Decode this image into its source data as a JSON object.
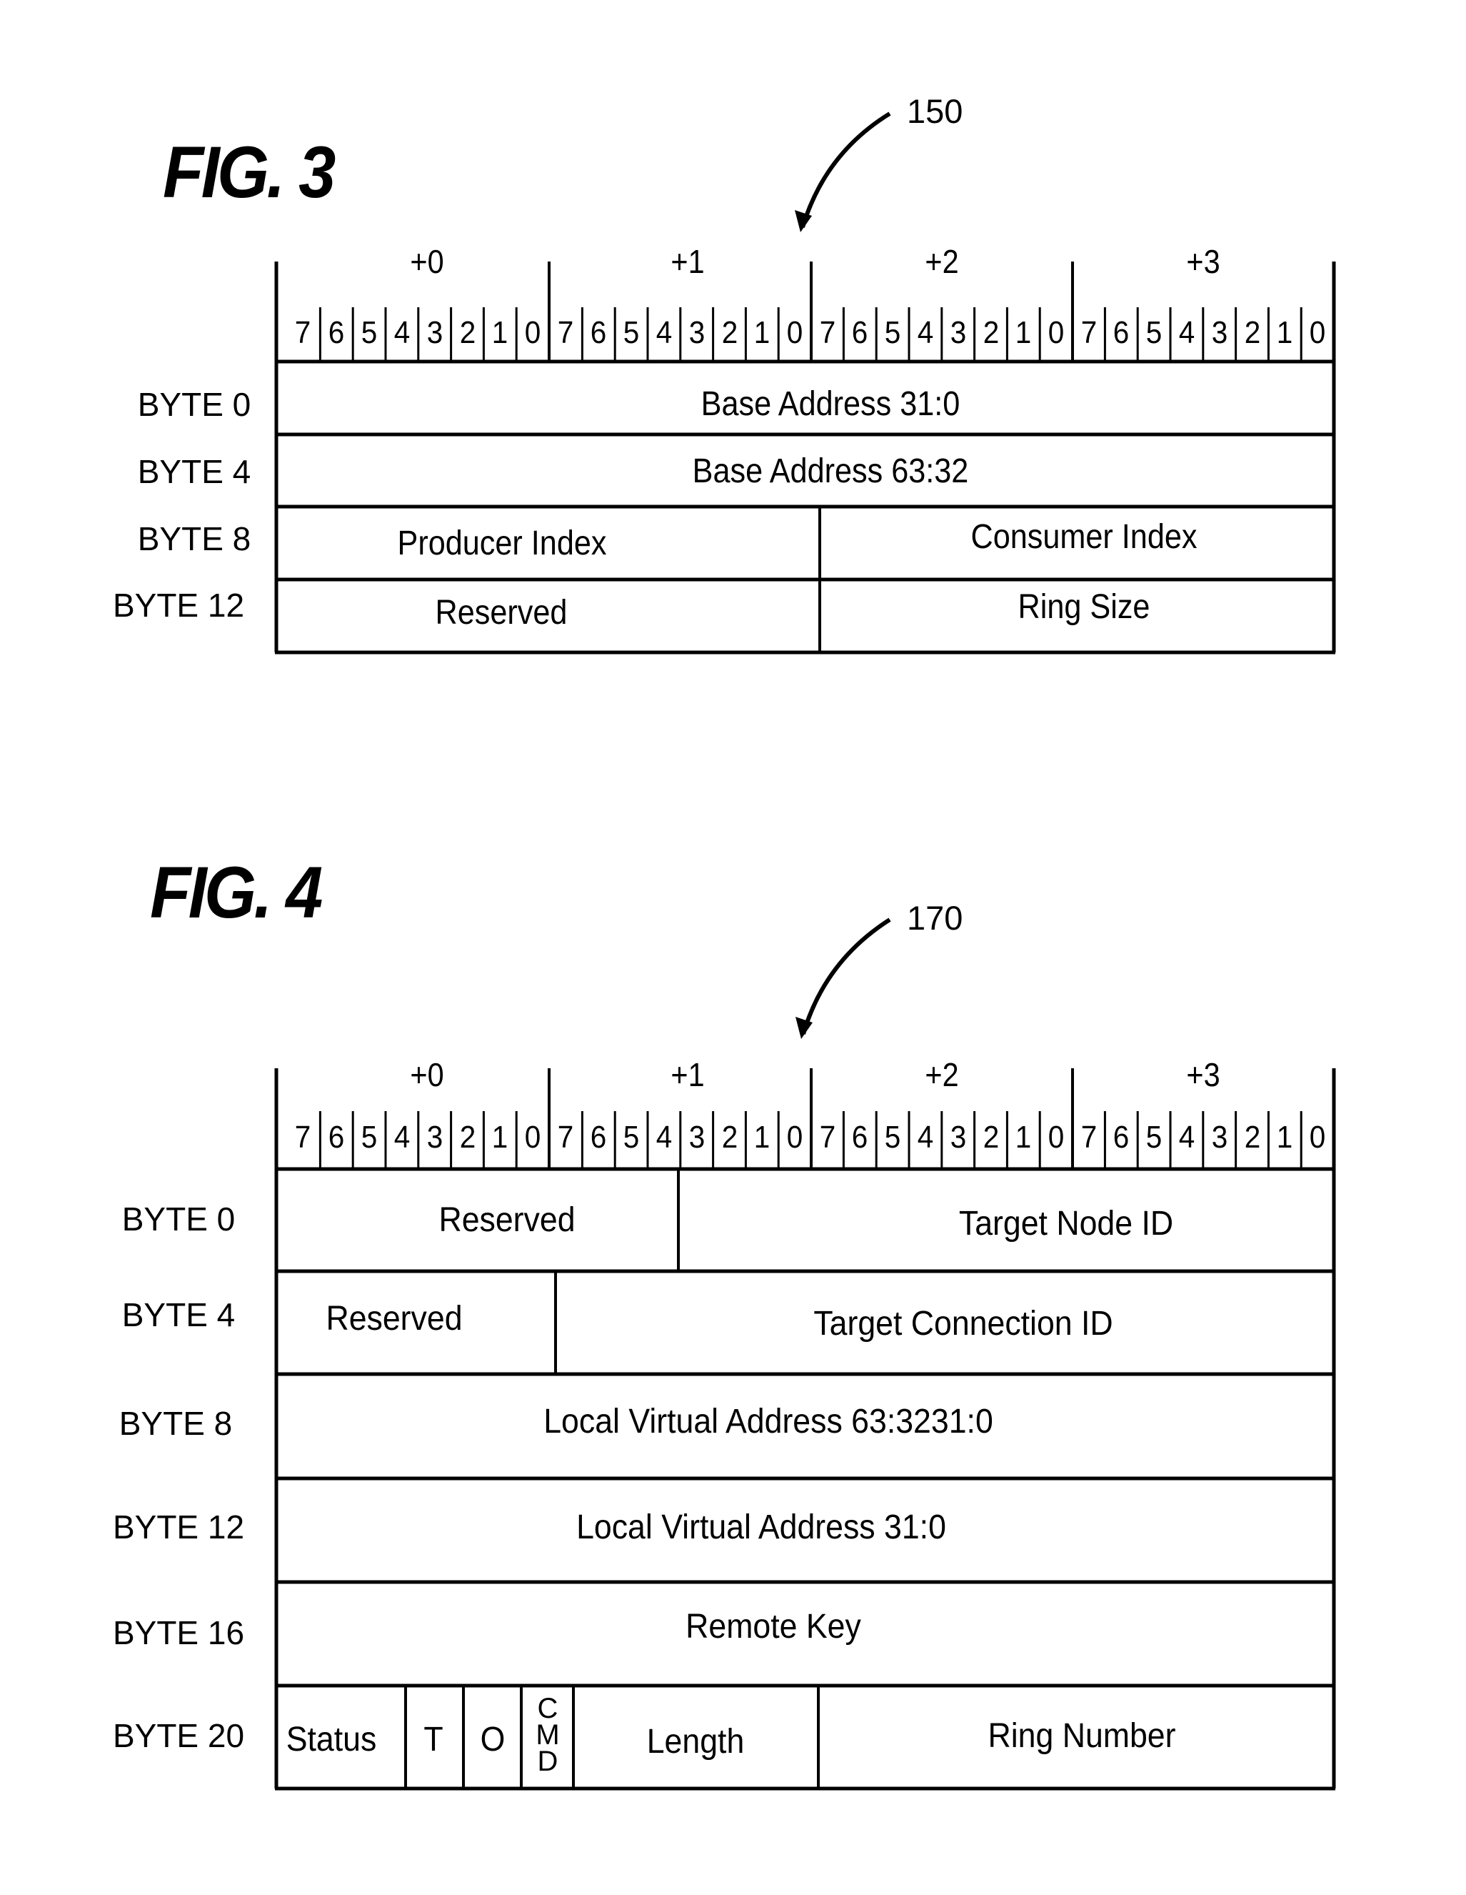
{
  "figures": [
    {
      "title": "FIG. 3",
      "reference": "150",
      "byte_headers": [
        "+0",
        "+1",
        "+2",
        "+3"
      ],
      "bit_labels": [
        "7",
        "6",
        "5",
        "4",
        "3",
        "2",
        "1",
        "0"
      ],
      "rows": [
        {
          "label": "BYTE 0",
          "fields": [
            {
              "name": "Base Address 31:0",
              "bits": 32
            }
          ]
        },
        {
          "label": "BYTE 4",
          "fields": [
            {
              "name": "Base Address 63:32",
              "bits": 32
            }
          ]
        },
        {
          "label": "BYTE 8",
          "fields": [
            {
              "name": "Producer Index",
              "bits": 16
            },
            {
              "name": "Consumer Index",
              "bits": 16
            }
          ]
        },
        {
          "label": "BYTE 12",
          "fields": [
            {
              "name": "Reserved",
              "bits": 16
            },
            {
              "name": "Ring Size",
              "bits": 16
            }
          ]
        }
      ]
    },
    {
      "title": "FIG. 4",
      "reference": "170",
      "byte_headers": [
        "+0",
        "+1",
        "+2",
        "+3"
      ],
      "bit_labels": [
        "7",
        "6",
        "5",
        "4",
        "3",
        "2",
        "1",
        "0"
      ],
      "rows": [
        {
          "label": "BYTE 0",
          "fields": [
            {
              "name": "Reserved",
              "bits": 12
            },
            {
              "name": "Target Node ID",
              "bits": 20
            }
          ]
        },
        {
          "label": "BYTE 4",
          "fields": [
            {
              "name": "Reserved"
            },
            {
              "name": "Target Connection ID"
            }
          ]
        },
        {
          "label": "BYTE 8",
          "fields": [
            {
              "name": "Local Virtual Address 63:3231:0",
              "bits": 32
            }
          ]
        },
        {
          "label": "BYTE 12",
          "fields": [
            {
              "name": "Local Virtual Address 31:0",
              "bits": 32
            }
          ]
        },
        {
          "label": "BYTE 16",
          "fields": [
            {
              "name": "Remote Key",
              "bits": 32
            }
          ]
        },
        {
          "label": "BYTE 20",
          "fields": [
            {
              "name": "Status"
            },
            {
              "name": "T"
            },
            {
              "name": "O"
            },
            {
              "name": "CMD",
              "stacked": [
                "C",
                "M",
                "D"
              ]
            },
            {
              "name": "Length"
            },
            {
              "name": "Ring Number"
            }
          ]
        }
      ]
    }
  ]
}
